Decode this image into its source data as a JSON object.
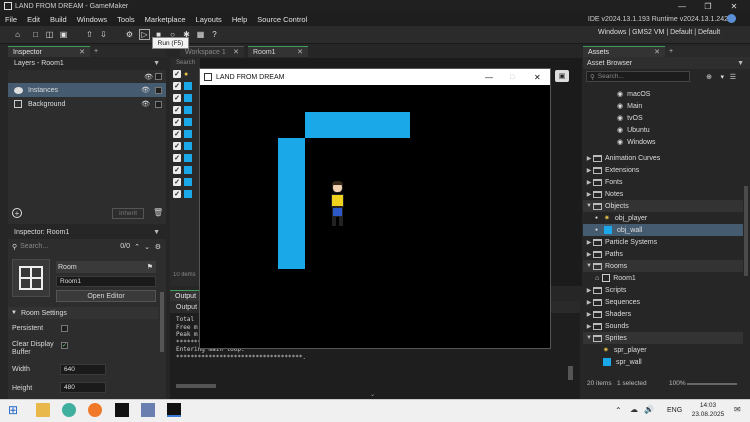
{
  "window": {
    "title": "LAND FROM DREAM - GameMaker"
  },
  "menu": [
    "File",
    "Edit",
    "Build",
    "Windows",
    "Tools",
    "Marketplace",
    "Layouts",
    "Help",
    "Source Control"
  ],
  "ide_version": "IDE v2024.13.1.193  Runtime v2024.13.1.242",
  "toolbar": {
    "tooltip": "Run (F5)",
    "target": "Windows | GMS2 VM | Default | Default"
  },
  "inspector_top": {
    "tab": "Inspector",
    "layers_title": "Layers - Room1",
    "layers": [
      {
        "label": "Instances"
      },
      {
        "label": "Background"
      }
    ],
    "inherit_label": "Inherit"
  },
  "inspector_room": {
    "title": "Inspector: Room1",
    "search_placeholder": "Search...",
    "count": "0/0",
    "room_label": "Room",
    "room_name": "Room1",
    "open_editor": "Open Editor",
    "settings_title": "Room Settings",
    "persistent": "Persistent",
    "clear_display": "Clear Display",
    "buffer": "Buffer",
    "width_label": "Width",
    "width_value": "640",
    "height_label": "Height",
    "height_value": "480"
  },
  "center_tabs": {
    "workspace": "Workspace 1",
    "room": "Room1",
    "search": "Search"
  },
  "instances_count": "10 items",
  "output": {
    "tab": "Output",
    "subtab": "Output",
    "lines": [
      "Total",
      "Free m",
      "Peak m",
      "***********************************.",
      "Entering main loop.",
      "***********************************."
    ]
  },
  "game_window": {
    "title": "LAND FROM DREAM"
  },
  "assets": {
    "tab": "Assets",
    "browser": "Asset Browser",
    "search_placeholder": "Search...",
    "platforms": [
      "macOS",
      "Main",
      "tvOS",
      "Ubuntu",
      "Windows"
    ],
    "folders": [
      {
        "label": "Animation Curves",
        "open": false
      },
      {
        "label": "Extensions",
        "open": false
      },
      {
        "label": "Fonts",
        "open": false
      },
      {
        "label": "Notes",
        "open": false
      },
      {
        "label": "Objects",
        "open": true,
        "children": [
          "obj_player",
          "obj_wall"
        ]
      },
      {
        "label": "Particle Systems",
        "open": false
      },
      {
        "label": "Paths",
        "open": false
      },
      {
        "label": "Rooms",
        "open": true,
        "children": [
          "Room1"
        ]
      },
      {
        "label": "Scripts",
        "open": false
      },
      {
        "label": "Sequences",
        "open": false
      },
      {
        "label": "Shaders",
        "open": false
      },
      {
        "label": "Sounds",
        "open": false
      },
      {
        "label": "Sprites",
        "open": true,
        "children": [
          "spr_player",
          "spr_wall"
        ]
      }
    ],
    "status_items": "20 items",
    "status_selected": "1 selected",
    "zoom": "100%"
  },
  "taskbar": {
    "lang": "ENG",
    "time": "14:03",
    "date": "23.08.2025"
  },
  "colors": {
    "accent": "#3d9f5a",
    "wall": "#1aa8e8",
    "selection": "#455b70"
  }
}
